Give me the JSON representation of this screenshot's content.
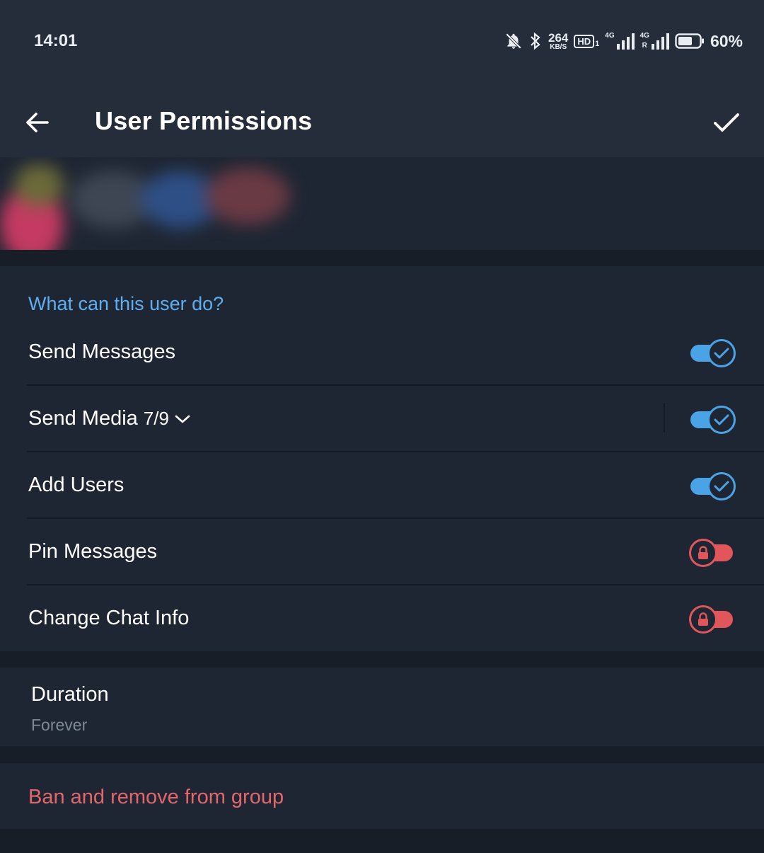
{
  "status_bar": {
    "time": "14:01",
    "speed_value": "264",
    "speed_unit": "KB/S",
    "hd_label": "HD",
    "sim1": "1",
    "network1": "4G",
    "network2": "4G",
    "roaming": "R",
    "battery": "60%"
  },
  "toolbar": {
    "title": "User Permissions"
  },
  "permissions": {
    "header": "What can this user do?",
    "items": [
      {
        "label": "Send Messages",
        "state": "on"
      },
      {
        "label": "Send Media",
        "count": "7/9",
        "state": "on"
      },
      {
        "label": "Add Users",
        "state": "on"
      },
      {
        "label": "Pin Messages",
        "state": "locked"
      },
      {
        "label": "Change Chat Info",
        "state": "locked"
      }
    ]
  },
  "duration": {
    "label": "Duration",
    "value": "Forever"
  },
  "ban": {
    "label": "Ban and remove from group"
  },
  "colors": {
    "accent_blue": "#5eaef0",
    "toggle_on": "#4aa3e6",
    "locked_red": "#e0565a",
    "danger_text": "#e3676a",
    "background": "#181e28",
    "surface": "#1f2633",
    "header_surface": "#252d3a"
  },
  "icons": {
    "back": "arrow-left-icon",
    "confirm": "check-icon",
    "toggle_on": "check-circle-icon",
    "toggle_locked": "lock-icon",
    "expand": "chevron-down-icon"
  }
}
